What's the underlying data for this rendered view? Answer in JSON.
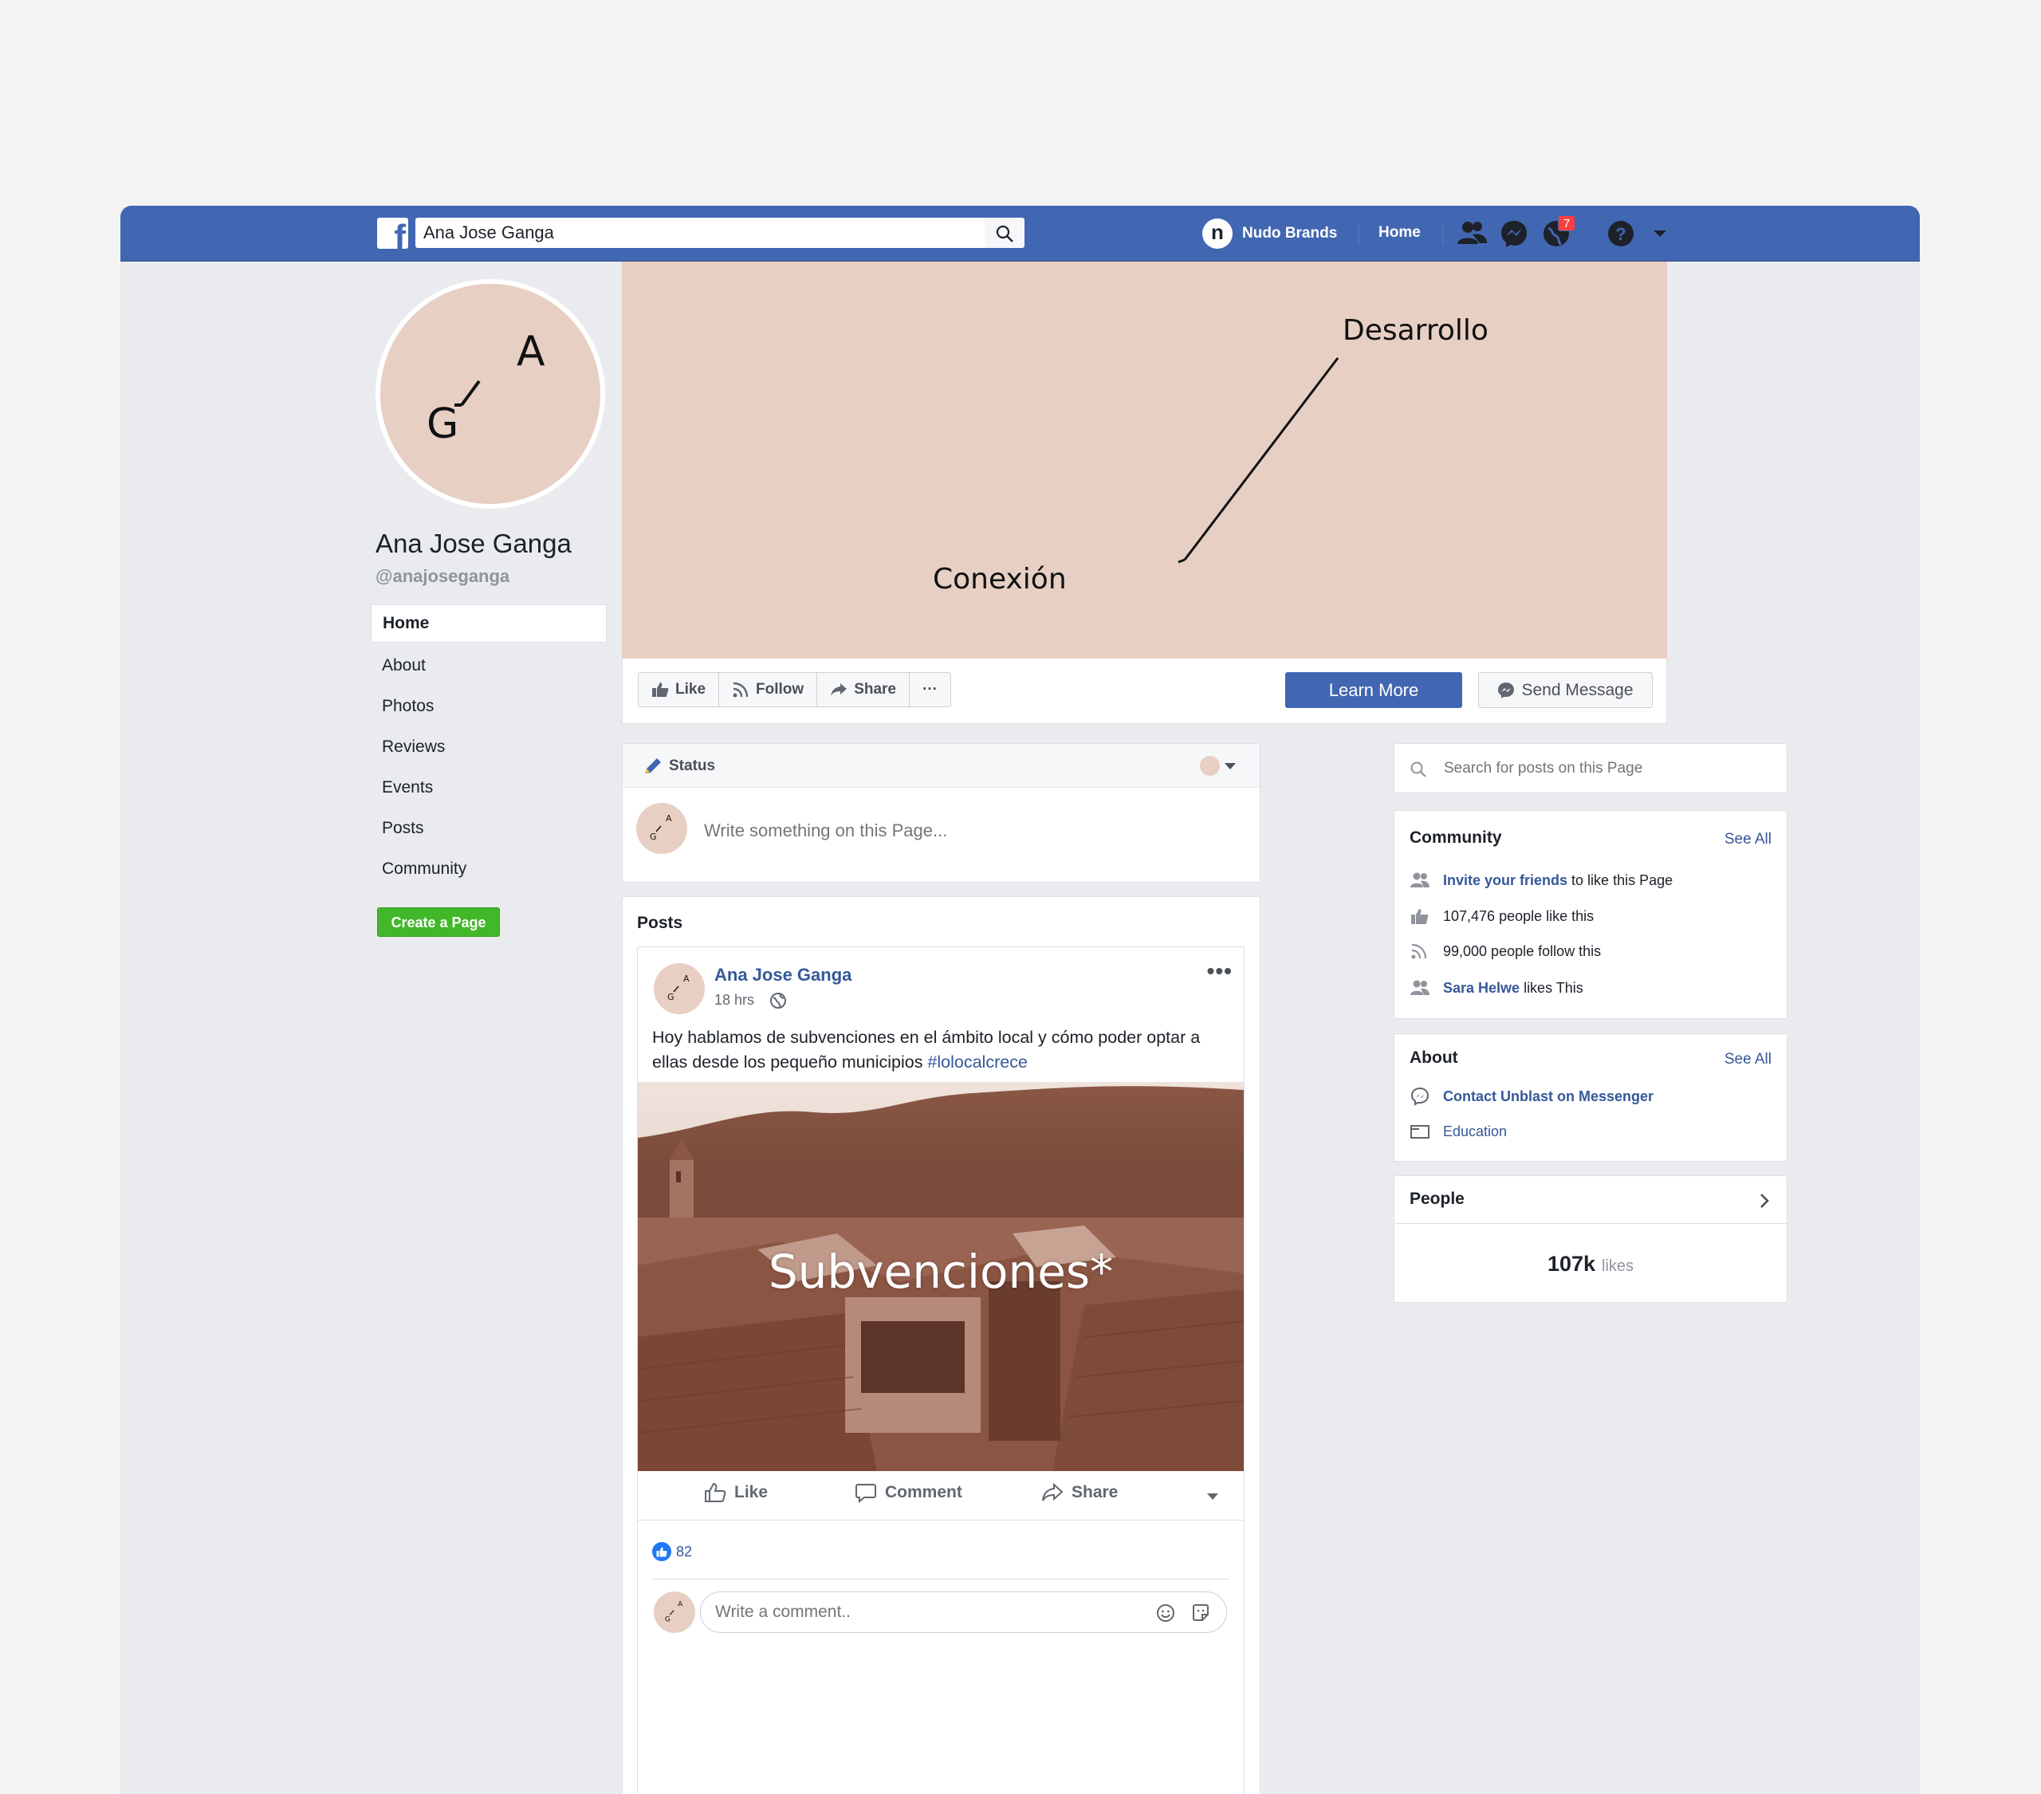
{
  "search": {
    "value": "Ana Jose Ganga"
  },
  "topnav": {
    "user_initial": "n",
    "user_name": "Nudo Brands",
    "home_label": "Home",
    "notifications_count": "7"
  },
  "profile": {
    "monogram": {
      "a": "A",
      "g": "G"
    },
    "name": "Ana Jose Ganga",
    "handle": "@anajoseganga"
  },
  "left_nav": {
    "items": [
      "Home",
      "About",
      "Photos",
      "Reviews",
      "Events",
      "Posts",
      "Community"
    ],
    "active": "Home",
    "create_page": "Create a Page"
  },
  "cover": {
    "word_top": "Desarrollo",
    "word_bottom": "Conexión",
    "background": "#e7cfc3"
  },
  "actions": {
    "like": "Like",
    "follow": "Follow",
    "share": "Share",
    "more": "···",
    "learn_more": "Learn More",
    "send_message": "Send Message"
  },
  "composer": {
    "tab": "Status",
    "placeholder": "Write something on this Page..."
  },
  "posts": {
    "title": "Posts",
    "post": {
      "author": "Ana Jose Ganga",
      "time": "18 hrs",
      "text": "Hoy hablamos de subvenciones en el ámbito local y cómo poder optar a ellas desde los pequeño municipios ",
      "hashtag": "#lolocalcrece",
      "image_caption": "Subvenciones*",
      "like": "Like",
      "comment": "Comment",
      "share": "Share",
      "reaction_count": "82",
      "comment_placeholder": "Write a comment.."
    }
  },
  "page_search": {
    "placeholder": "Search for posts on this Page"
  },
  "community": {
    "title": "Community",
    "see_all": "See All",
    "invite_link": "Invite your friends",
    "invite_rest": " to like this Page",
    "likes_text": "107,476 people like this",
    "follows_text": "99,000 people follow this",
    "friend_name": "Sara Helwe",
    "friend_rest": " likes This"
  },
  "about": {
    "title": "About",
    "see_all": "See All",
    "messenger": "Contact Unblast on Messenger",
    "education": "Education"
  },
  "people": {
    "title": "People",
    "likes_count": "107k",
    "likes_label": "likes"
  },
  "colors": {
    "brand_blue": "#4267b2",
    "link": "#365899",
    "green": "#42b72a",
    "blush": "#e7cfc3",
    "badge": "#fa3e3e"
  }
}
